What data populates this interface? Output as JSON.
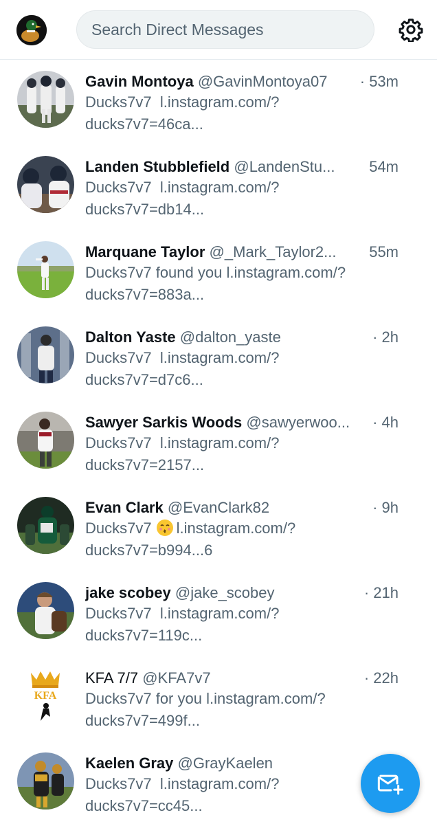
{
  "header": {
    "search_placeholder": "Search Direct Messages",
    "settings_icon": "gear-icon",
    "compose_icon": "new-message-icon"
  },
  "colors": {
    "accent": "#1d9bf0",
    "secondary_text": "#536471",
    "primary_text": "#0f1419",
    "search_bg": "#eff3f4"
  },
  "conversations": [
    {
      "name": "Gavin Montoya",
      "handle": "@GavinMontoya07",
      "time": "· 53m",
      "message": "Ducks7v7  l.instagram.com/?\nducks7v7=46ca..."
    },
    {
      "name": "Landen Stubblefield",
      "handle": "@LandenStu...",
      "time": "54m",
      "message": "Ducks7v7  l.instagram.com/?\nducks7v7=db14..."
    },
    {
      "name": "Marquane Taylor",
      "handle": "@_Mark_Taylor2...",
      "time": "55m",
      "message": "Ducks7v7 found you l.instagram.com/?\nducks7v7=883a..."
    },
    {
      "name": "Dalton Yaste",
      "handle": "@dalton_yaste",
      "time": "· 2h",
      "message": "Ducks7v7  l.instagram.com/?\nducks7v7=d7c6..."
    },
    {
      "name": "Sawyer Sarkis Woods",
      "handle": "@sawyerwoo...",
      "time": "· 4h",
      "message": "Ducks7v7  l.instagram.com/?\nducks7v7=2157..."
    },
    {
      "name": "Evan Clark",
      "handle": "@EvanClark82",
      "time": "· 9h",
      "message_before": "Ducks7v7",
      "message_after": "l.instagram.com/?\nducks7v7=b994...6",
      "emoji": "kissing-face-emoji"
    },
    {
      "name": "jake scobey",
      "handle": "@jake_scobey",
      "time": "· 21h",
      "message": "Ducks7v7  l.instagram.com/?\nducks7v7=119c..."
    },
    {
      "name": "KFA 7/7",
      "handle": "@KFA7v7",
      "time": "· 22h",
      "message": "Ducks7v7 for you l.instagram.com/?\nducks7v7=499f...",
      "avatar_text": "KFA"
    },
    {
      "name": "Kaelen Gray",
      "handle": "@GrayKaelen",
      "message": "Ducks7v7  l.instagram.com/?\nducks7v7=cc45..."
    }
  ]
}
